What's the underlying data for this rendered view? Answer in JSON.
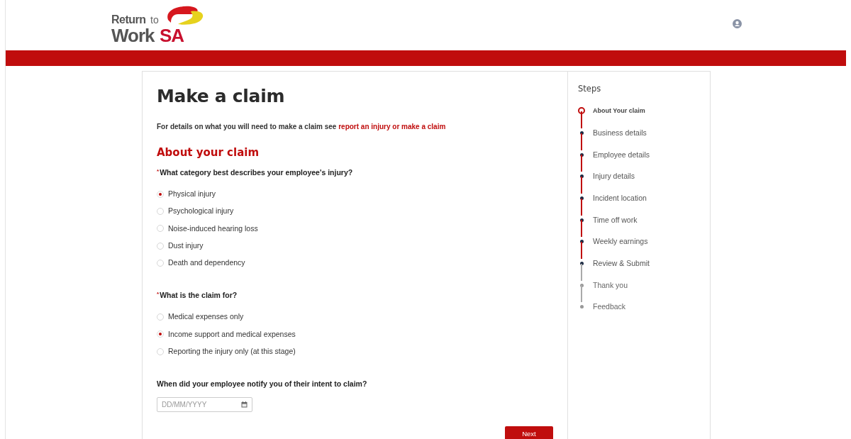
{
  "header": {
    "logo": {
      "word_1": "Return",
      "word_2": "to",
      "word_3": "Work",
      "word_4": "SA"
    }
  },
  "form": {
    "title": "Make a claim",
    "intro": {
      "text": "For details on what you will need to make a claim see",
      "link": "report an injury or make a claim"
    },
    "section_title": "About your claim",
    "questions": [
      {
        "required_mark": "*",
        "label": "What category best describes your employee's injury?",
        "options": [
          {
            "label": "Physical injury",
            "selected": true
          },
          {
            "label": "Psychological injury",
            "selected": false
          },
          {
            "label": "Noise-induced hearing loss",
            "selected": false
          },
          {
            "label": "Dust injury",
            "selected": false
          },
          {
            "label": "Death and dependency",
            "selected": false
          }
        ]
      },
      {
        "required_mark": "*",
        "label": "What is the claim for?",
        "options": [
          {
            "label": "Medical expenses only",
            "selected": false
          },
          {
            "label": "Income support and medical expenses",
            "selected": true
          },
          {
            "label": "Reporting the injury only (at this stage)",
            "selected": false
          }
        ]
      }
    ],
    "date_question": {
      "label": "When did your employee notify you of their intent to claim?",
      "placeholder": "DD/MM/YYYY"
    },
    "next_button": "Next"
  },
  "steps": {
    "title": "Steps",
    "items": [
      {
        "label": "About Your claim",
        "current": true,
        "enabled": true
      },
      {
        "label": "Business details",
        "current": false,
        "enabled": true
      },
      {
        "label": "Employee details",
        "current": false,
        "enabled": true
      },
      {
        "label": "Injury details",
        "current": false,
        "enabled": true
      },
      {
        "label": "Incident location",
        "current": false,
        "enabled": true
      },
      {
        "label": "Time off work",
        "current": false,
        "enabled": true
      },
      {
        "label": "Weekly earnings",
        "current": false,
        "enabled": true
      },
      {
        "label": "Review & Submit",
        "current": false,
        "enabled": true
      },
      {
        "label": "Thank you",
        "current": false,
        "enabled": false
      },
      {
        "label": "Feedback",
        "current": false,
        "enabled": false
      }
    ]
  }
}
